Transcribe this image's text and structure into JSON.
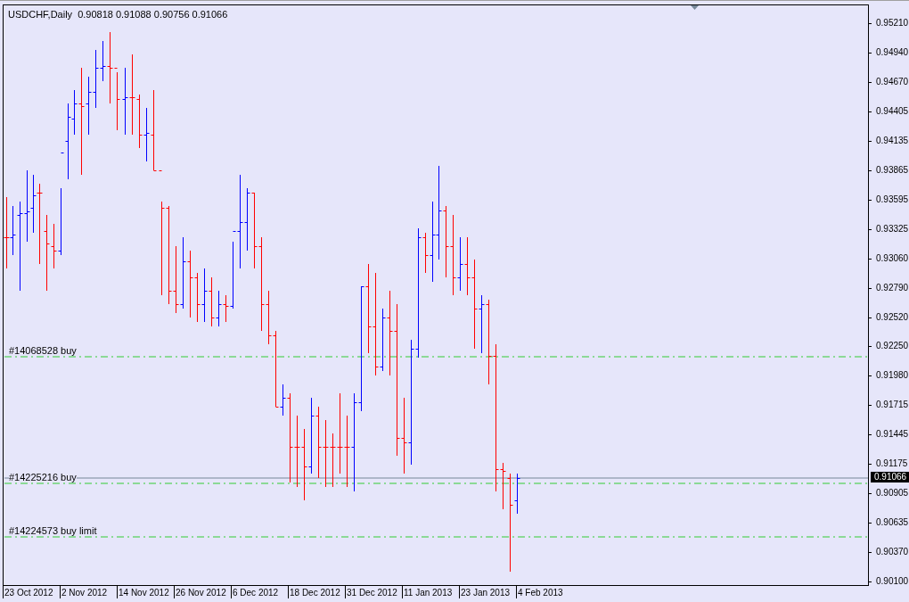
{
  "header": {
    "symbol": "USDCHF,Daily",
    "quotes": "0.90818 0.91088 0.90756 0.91066"
  },
  "price_axis": {
    "labels": [
      "0.95210",
      "0.94940",
      "0.94670",
      "0.94405",
      "0.94135",
      "0.93865",
      "0.93595",
      "0.93325",
      "0.93060",
      "0.92790",
      "0.92520",
      "0.92250",
      "0.91980",
      "0.91715",
      "0.91445",
      "0.91175",
      "0.90905",
      "0.90635",
      "0.90370",
      "0.90100"
    ],
    "current": "0.91066"
  },
  "time_axis": {
    "labels": [
      "23 Oct 2012",
      "2 Nov 2012",
      "14 Nov 2012",
      "26 Nov 2012",
      "6 Dec 2012",
      "18 Dec 2012",
      "31 Dec 2012",
      "11 Jan 2013",
      "23 Jan 2013",
      "4 Feb 2013"
    ]
  },
  "orders": [
    {
      "label": "#14068528 buy"
    },
    {
      "label": "#14225216 buy"
    },
    {
      "label": "#14224573 buy limit"
    }
  ]
}
